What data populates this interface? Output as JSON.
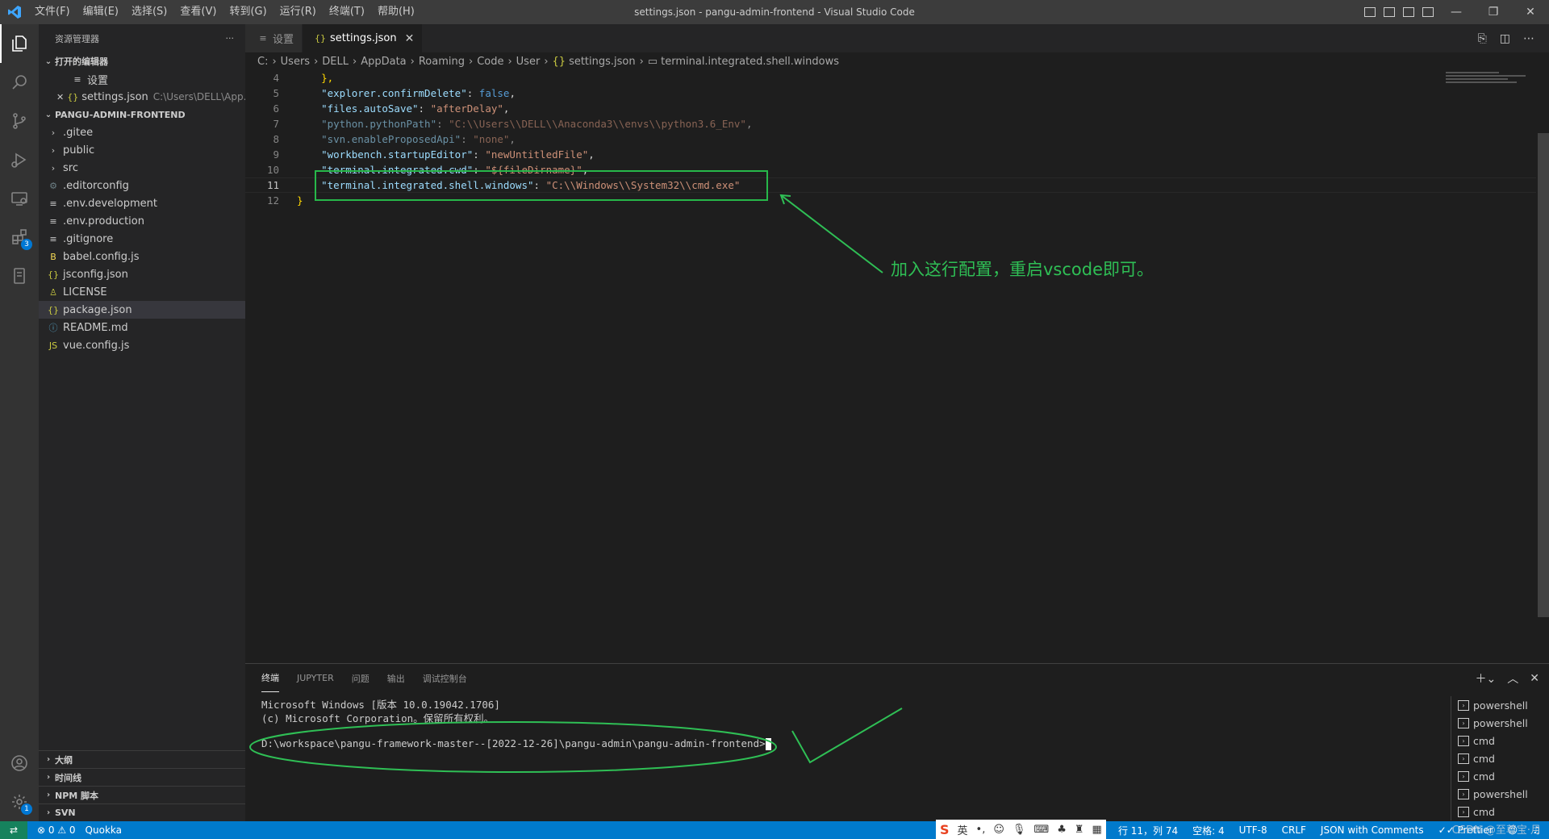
{
  "titlebar": {
    "menus": [
      "文件(F)",
      "编辑(E)",
      "选择(S)",
      "查看(V)",
      "转到(G)",
      "运行(R)",
      "终端(T)",
      "帮助(H)"
    ],
    "title": "settings.json - pangu-admin-frontend - Visual Studio Code"
  },
  "sidebar": {
    "header": "资源管理器",
    "more": "···",
    "open_editors_title": "打开的编辑器",
    "open_editors": [
      {
        "label": "设置",
        "path": ""
      },
      {
        "label": "settings.json",
        "path": "C:\\Users\\DELL\\App..."
      }
    ],
    "project_title": "PANGU-ADMIN-FRONTEND",
    "files": [
      {
        "name": ".gitee",
        "icon": "folder-icon",
        "glyph": "›"
      },
      {
        "name": "public",
        "icon": "folder-icon",
        "glyph": "›"
      },
      {
        "name": "src",
        "icon": "folder-icon",
        "glyph": "›"
      },
      {
        "name": ".editorconfig",
        "icon": "gear-icon",
        "glyph": "⚙"
      },
      {
        "name": ".env.development",
        "icon": "lines-icon",
        "glyph": "≡"
      },
      {
        "name": ".env.production",
        "icon": "lines-icon",
        "glyph": "≡"
      },
      {
        "name": ".gitignore",
        "icon": "lines-icon",
        "glyph": "≡"
      },
      {
        "name": "babel.config.js",
        "icon": "babel-icon",
        "glyph": "B"
      },
      {
        "name": "jsconfig.json",
        "icon": "json-icon",
        "glyph": "{}"
      },
      {
        "name": "LICENSE",
        "icon": "license-icon",
        "glyph": "♙"
      },
      {
        "name": "package.json",
        "icon": "json-icon",
        "glyph": "{}"
      },
      {
        "name": "README.md",
        "icon": "info-icon",
        "glyph": "ⓘ"
      },
      {
        "name": "vue.config.js",
        "icon": "js-icon",
        "glyph": "JS"
      }
    ],
    "bottom_sections": [
      "大纲",
      "时间线",
      "NPM 脚本",
      "SVN"
    ]
  },
  "activity": {
    "extensions_badge": "3",
    "settings_badge": "1"
  },
  "editor": {
    "tabs": [
      {
        "label": "设置",
        "icon": "≡"
      },
      {
        "label": "settings.json",
        "icon": "{}"
      }
    ],
    "breadcrumb": [
      "C:",
      "Users",
      "DELL",
      "AppData",
      "Roaming",
      "Code",
      "User",
      "settings.json",
      "terminal.integrated.shell.windows"
    ],
    "lines": [
      {
        "n": "4",
        "key": "",
        "val": "",
        "raw": "    },"
      },
      {
        "n": "5",
        "key": "\"explorer.confirmDelete\"",
        "val": "false",
        "valtype": "b"
      },
      {
        "n": "6",
        "key": "\"files.autoSave\"",
        "val": "\"afterDelay\"",
        "valtype": "s"
      },
      {
        "n": "7",
        "key": "\"python.pythonPath\"",
        "val": "\"C:\\\\Users\\\\DELL\\\\Anaconda3\\\\envs\\\\python3.6_Env\"",
        "valtype": "s",
        "dim": true
      },
      {
        "n": "8",
        "key": "\"svn.enableProposedApi\"",
        "val": "\"none\"",
        "valtype": "s",
        "dim": true
      },
      {
        "n": "9",
        "key": "\"workbench.startupEditor\"",
        "val": "\"newUntitledFile\"",
        "valtype": "s"
      },
      {
        "n": "10",
        "key": "\"terminal.integrated.cwd\"",
        "val": "\"${fileDirname}\"",
        "valtype": "s"
      },
      {
        "n": "11",
        "key": "\"terminal.integrated.shell.windows\"",
        "val": "\"C:\\\\Windows\\\\System32\\\\cmd.exe\"",
        "valtype": "s",
        "last": true
      },
      {
        "n": "12",
        "key": "",
        "val": "",
        "raw": "}"
      }
    ],
    "annotation": "加入这行配置，重启vscode即可。"
  },
  "panel": {
    "tabs": [
      "终端",
      "JUPYTER",
      "问题",
      "输出",
      "调试控制台"
    ],
    "terminal_lines": [
      "Microsoft Windows [版本 10.0.19042.1706]",
      "(c) Microsoft Corporation。保留所有权利。",
      "",
      "D:\\workspace\\pangu-framework-master--[2022-12-26]\\pangu-admin\\pangu-admin-frontend>"
    ],
    "terminals": [
      "powershell",
      "powershell",
      "cmd",
      "cmd",
      "cmd",
      "powershell",
      "cmd"
    ]
  },
  "statusbar": {
    "errors": "0",
    "warnings": "0",
    "quokka": "Quokka",
    "position": "行 11，列 74",
    "spaces": "空格: 4",
    "encoding": "UTF-8",
    "eol": "CRLF",
    "language": "JSON with Comments",
    "prettier": "Prettier",
    "ime_lang": "英",
    "watermark": "CSDN @至尊宝·月"
  },
  "colors": {
    "accent": "#007acc",
    "annotation": "#2fbf55"
  }
}
